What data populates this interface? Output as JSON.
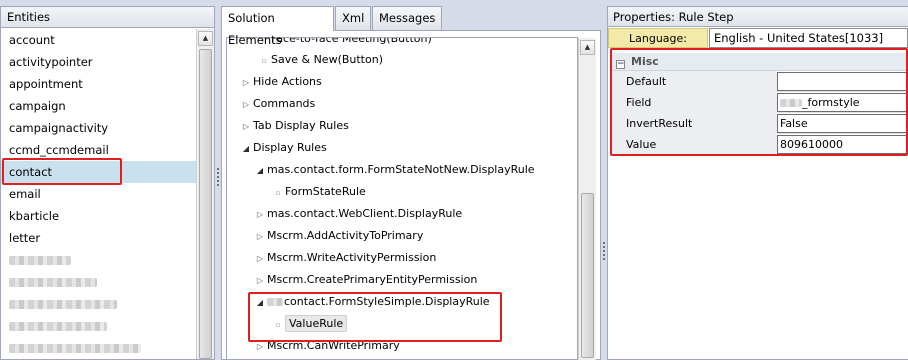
{
  "entities": {
    "title": "Entities",
    "items": [
      "account",
      "activitypointer",
      "appointment",
      "campaign",
      "campaignactivity",
      "ccmd_ccmdemail",
      "contact",
      "email",
      "kbarticle",
      "letter"
    ],
    "selected": "contact"
  },
  "solution": {
    "tabs": [
      "Solution Elements",
      "Xml",
      "Messages"
    ],
    "active_tab": "Solution Elements",
    "tree": [
      "Face-to-face Meeting(Button)",
      "Save & New(Button)",
      "Hide Actions",
      "Commands",
      "Tab Display Rules",
      "Display Rules",
      "mas.contact.form.FormStateNotNew.DisplayRule",
      "FormStateRule",
      "mas.contact.WebClient.DisplayRule",
      "Mscrm.AddActivityToPrimary",
      "Mscrm.WriteActivityPermission",
      "Mscrm.CreatePrimaryEntityPermission",
      "contact.FormStyleSimple.DisplayRule",
      "ValueRule",
      "Mscrm.CanWritePrimary"
    ]
  },
  "properties": {
    "title": "Properties: Rule Step",
    "language_label": "Language:",
    "language_value": "English - United States[1033]",
    "category": "Misc",
    "category_toggle": "−",
    "rows": [
      {
        "name": "Default",
        "value": ""
      },
      {
        "name": "Field",
        "value": "_formstyle"
      },
      {
        "name": "InvertResult",
        "value": "False"
      },
      {
        "name": "Value",
        "value": "809610000"
      }
    ]
  },
  "colors": {
    "highlight": "#e02020",
    "selection": "#c9e0ee",
    "language_label_bg": "#f3e9a8"
  }
}
